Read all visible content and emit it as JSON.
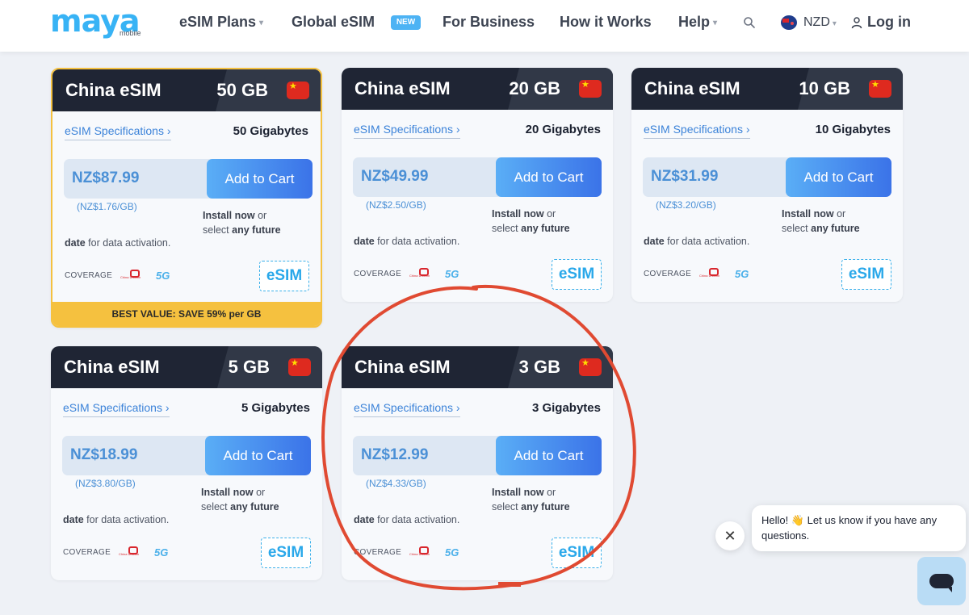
{
  "header": {
    "logo_text": "maya",
    "logo_sub": "mobile",
    "nav": [
      {
        "label": "eSIM Plans",
        "has_dropdown": true
      },
      {
        "label": "Global eSIM",
        "badge": "NEW"
      },
      {
        "label": "For Business"
      },
      {
        "label": "How it Works"
      },
      {
        "label": "Help",
        "has_dropdown": true
      }
    ],
    "currency": "NZD",
    "login": "Log in"
  },
  "cards": [
    {
      "title": "China eSIM",
      "gb": "50 GB",
      "spec_link": "eSIM Specifications ›",
      "gigabytes": "50 Gigabytes",
      "price": "NZ$87.99",
      "cart": "Add to Cart",
      "per_gb": "(NZ$1.76/GB)",
      "install_1": "Install now",
      "install_2": " or",
      "install_3": "select ",
      "install_4": "any future",
      "date_1": "date",
      "date_2": " for data activation.",
      "coverage": "COVERAGE",
      "network": "5G",
      "badge": "eSIM",
      "banner": "BEST VALUE: SAVE 59% per GB"
    },
    {
      "title": "China eSIM",
      "gb": "20 GB",
      "spec_link": "eSIM Specifications ›",
      "gigabytes": "20 Gigabytes",
      "price": "NZ$49.99",
      "cart": "Add to Cart",
      "per_gb": "(NZ$2.50/GB)",
      "install_1": "Install now",
      "install_2": " or",
      "install_3": "select ",
      "install_4": "any future",
      "date_1": "date",
      "date_2": " for data activation.",
      "coverage": "COVERAGE",
      "network": "5G",
      "badge": "eSIM"
    },
    {
      "title": "China eSIM",
      "gb": "10 GB",
      "spec_link": "eSIM Specifications ›",
      "gigabytes": "10 Gigabytes",
      "price": "NZ$31.99",
      "cart": "Add to Cart",
      "per_gb": "(NZ$3.20/GB)",
      "install_1": "Install now",
      "install_2": " or",
      "install_3": "select ",
      "install_4": "any future",
      "date_1": "date",
      "date_2": " for data activation.",
      "coverage": "COVERAGE",
      "network": "5G",
      "badge": "eSIM"
    },
    {
      "title": "China eSIM",
      "gb": "5 GB",
      "spec_link": "eSIM Specifications ›",
      "gigabytes": "5 Gigabytes",
      "price": "NZ$18.99",
      "cart": "Add to Cart",
      "per_gb": "(NZ$3.80/GB)",
      "install_1": "Install now",
      "install_2": " or",
      "install_3": "select ",
      "install_4": "any future",
      "date_1": "date",
      "date_2": " for data activation.",
      "coverage": "COVERAGE",
      "network": "5G",
      "badge": "eSIM"
    },
    {
      "title": "China eSIM",
      "gb": "3 GB",
      "spec_link": "eSIM Specifications ›",
      "gigabytes": "3 Gigabytes",
      "price": "NZ$12.99",
      "cart": "Add to Cart",
      "per_gb": "(NZ$4.33/GB)",
      "install_1": "Install now",
      "install_2": " or",
      "install_3": "select ",
      "install_4": "any future",
      "date_1": "date",
      "date_2": " for data activation.",
      "coverage": "COVERAGE",
      "network": "5G",
      "badge": "eSIM"
    }
  ],
  "chat": {
    "close": "✕",
    "message": "Hello! 👋 Let us know if you have any questions."
  },
  "colors": {
    "accent": "#38b3f5",
    "card_header": "#1f2534",
    "featured": "#f5c13f",
    "annotation": "#e04a32"
  }
}
